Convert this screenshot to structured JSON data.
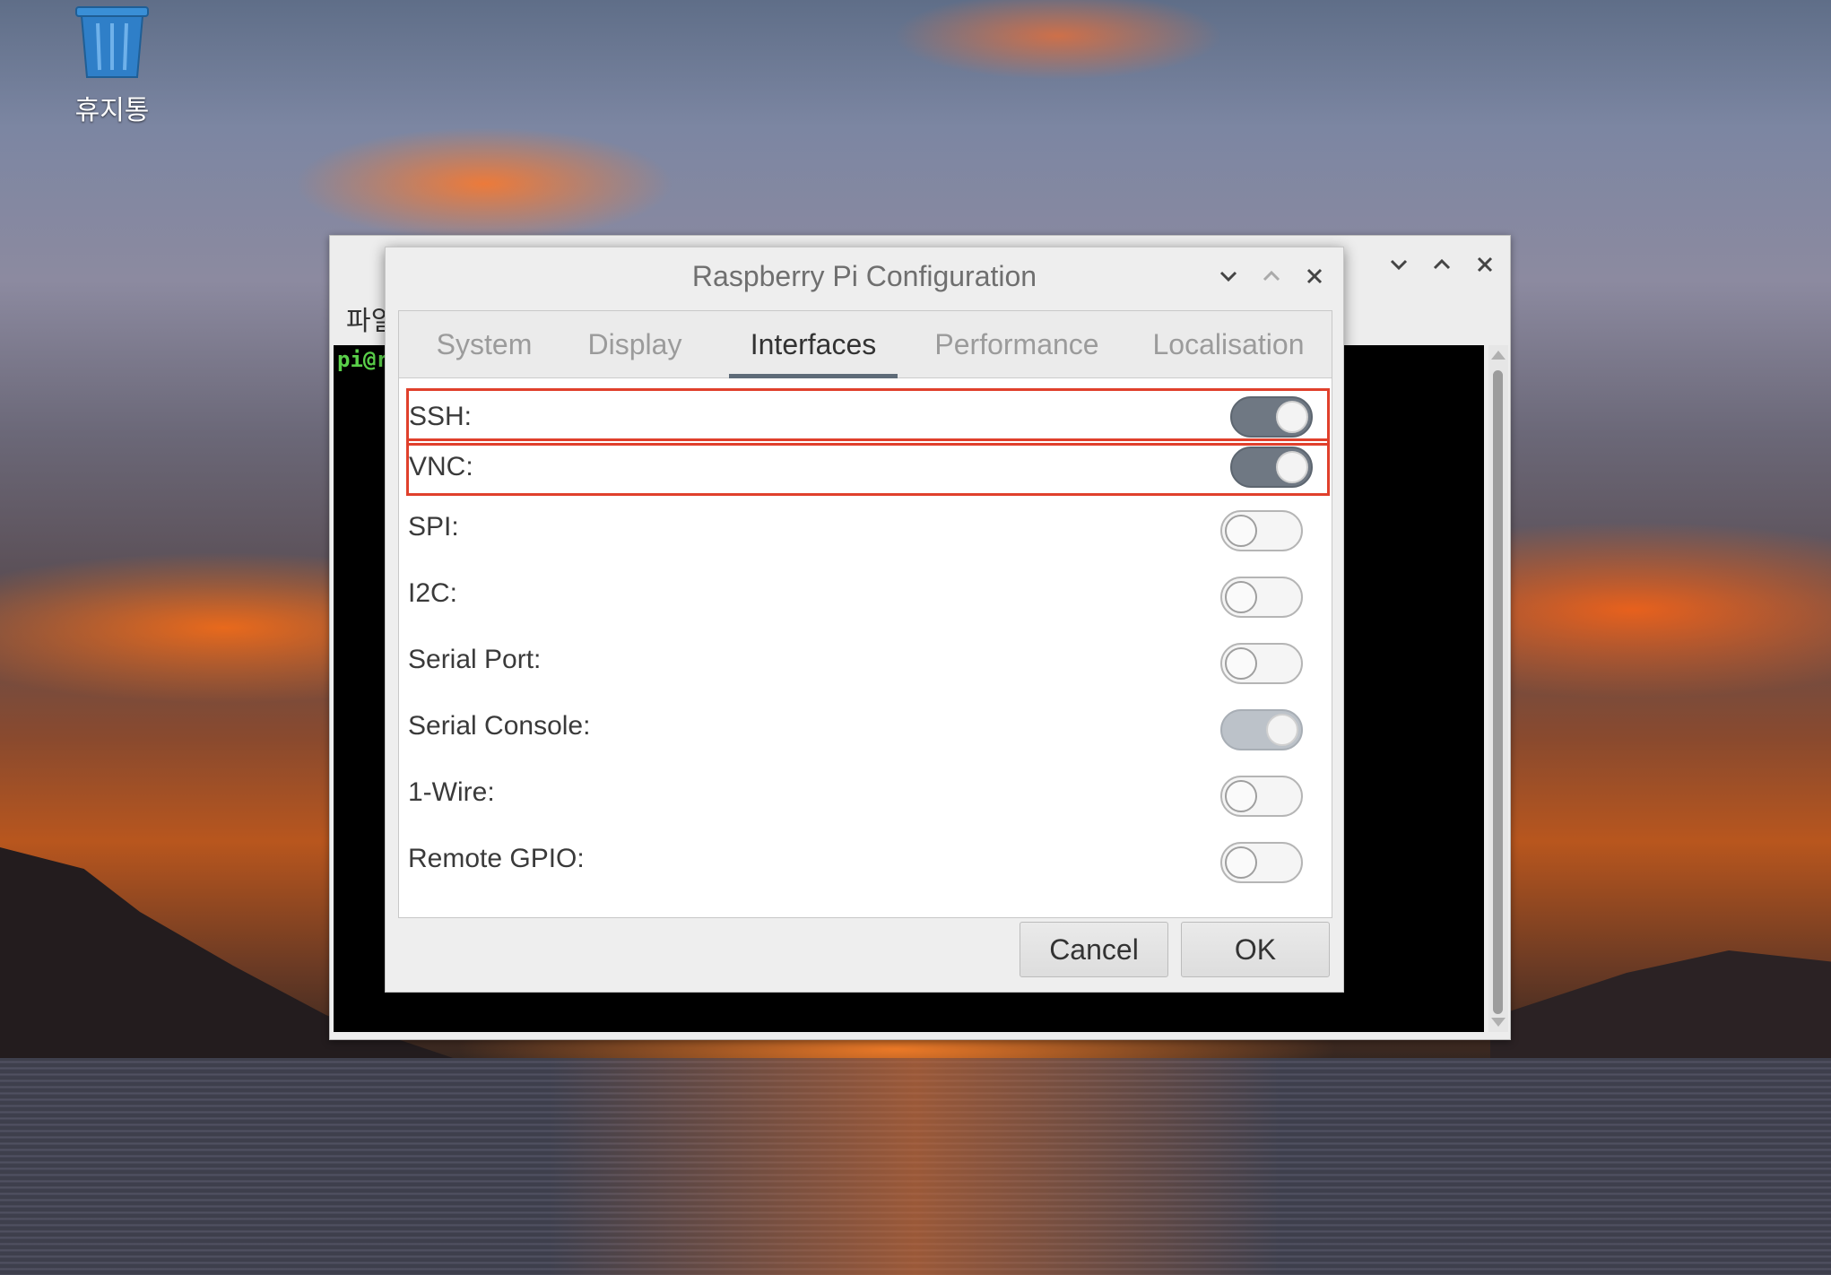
{
  "desktop": {
    "trash_label": "휴지통"
  },
  "terminal": {
    "menu_label": "파일",
    "prompt_text": "pi@r"
  },
  "dialog": {
    "title": "Raspberry Pi Configuration",
    "tabs": [
      {
        "label": "System",
        "active": false
      },
      {
        "label": "Display",
        "active": false
      },
      {
        "label": "Interfaces",
        "active": true
      },
      {
        "label": "Performance",
        "active": false
      },
      {
        "label": "Localisation",
        "active": false
      }
    ],
    "interfaces": [
      {
        "label": "SSH:",
        "enabled": true,
        "highlighted": true
      },
      {
        "label": "VNC:",
        "enabled": true,
        "highlighted": true
      },
      {
        "label": "SPI:",
        "enabled": false,
        "highlighted": false
      },
      {
        "label": "I2C:",
        "enabled": false,
        "highlighted": false
      },
      {
        "label": "Serial Port:",
        "enabled": false,
        "highlighted": false
      },
      {
        "label": "Serial Console:",
        "enabled": true,
        "highlighted": false,
        "insensitive": true
      },
      {
        "label": "1-Wire:",
        "enabled": false,
        "highlighted": false
      },
      {
        "label": "Remote GPIO:",
        "enabled": false,
        "highlighted": false
      }
    ],
    "buttons": {
      "cancel": "Cancel",
      "ok": "OK"
    }
  },
  "colors": {
    "highlight_border": "#e0402c",
    "switch_on": "#6f7883",
    "active_tab_underline": "#5e6b78",
    "terminal_prompt": "#5ad04a"
  }
}
